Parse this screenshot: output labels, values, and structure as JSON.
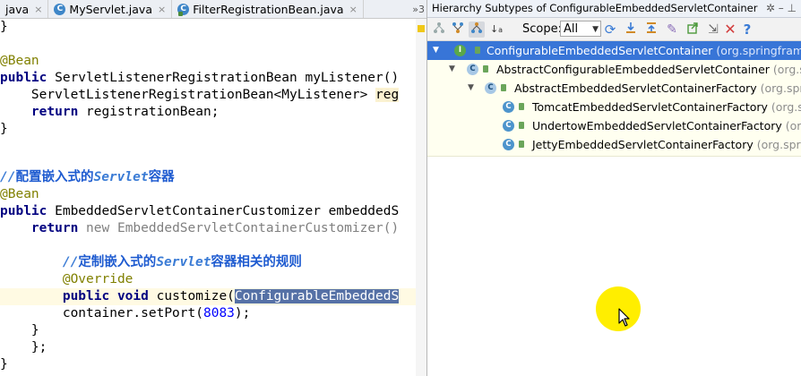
{
  "editor": {
    "tabs": [
      {
        "label": "java",
        "icon": "",
        "close": "×"
      },
      {
        "label": "MyServlet.java",
        "icon": "C",
        "close": "×"
      },
      {
        "label": "FilterRegistrationBean.java",
        "icon": "C",
        "close": "×"
      }
    ],
    "tab_overflow": "»3",
    "code": {
      "l0": "}",
      "l2_ann": "@Bean",
      "l3_kw": "public",
      "l3_rest": " ServletListenerRegistrationBean myListener()",
      "l4_pre": "    ServletListenerRegistrationBean<MyListener> ",
      "l4_hl": "reg",
      "l5_kw": "return",
      "l5_rest": " registrationBean;",
      "l6": "}",
      "l9_slashes": "//",
      "l9_zh1": "配置嵌入式的",
      "l9_en": "Servlet",
      "l9_zh2": "容器",
      "l10_ann": "@Bean",
      "l11_kw": "public",
      "l11_rest": " EmbeddedServletContainerCustomizer embeddedS",
      "l12_kw": "return",
      "l12_new": " new",
      "l12_rest": " EmbeddedServletContainerCustomizer()",
      "l14_slashes": "//",
      "l14_zh1": "定制嵌入式的",
      "l14_en": "Servlet",
      "l14_zh2": "容器相关的规则",
      "l15_ann": "@Override",
      "l16_kw": "public void",
      "l16_rest": " customize(",
      "l16_sel": "ConfigurableEmbeddedS",
      "l17_pre": "        container.setPort(",
      "l17_num": "8083",
      "l17_post": ");",
      "l18": "    }",
      "l19": "};",
      "l20": "}"
    }
  },
  "panel": {
    "title": "Hierarchy Subtypes of ConfigurableEmbeddedServletContainer",
    "header_icons": "✲ – ⊥",
    "toolbar": {
      "scope_label": "Scope:",
      "scope_value": "All"
    },
    "tree": [
      {
        "name": "ConfigurableEmbeddedServletContainer",
        "pkg": " (org.springframework",
        "icon": "I"
      },
      {
        "name": "AbstractConfigurableEmbeddedServletContainer",
        "pkg": " (org.sprin",
        "icon": "C"
      },
      {
        "name": "AbstractEmbeddedServletContainerFactory",
        "pkg": " (org.spring",
        "icon": "C"
      },
      {
        "name": "TomcatEmbeddedServletContainerFactory",
        "pkg": " (org.spring",
        "icon": "C"
      },
      {
        "name": "UndertowEmbeddedServletContainerFactory",
        "pkg": " (org.sp",
        "icon": "C"
      },
      {
        "name": "JettyEmbeddedServletContainerFactory",
        "pkg": " (org.springf",
        "icon": "C"
      }
    ]
  },
  "colors": {
    "keyword": "#000080",
    "annotation": "#808000",
    "number": "#0000ff",
    "comment": "#3a7bd5",
    "selection": "#5671a6",
    "tree_selected": "#3875d7",
    "cursor_halo": "#ffee00"
  }
}
